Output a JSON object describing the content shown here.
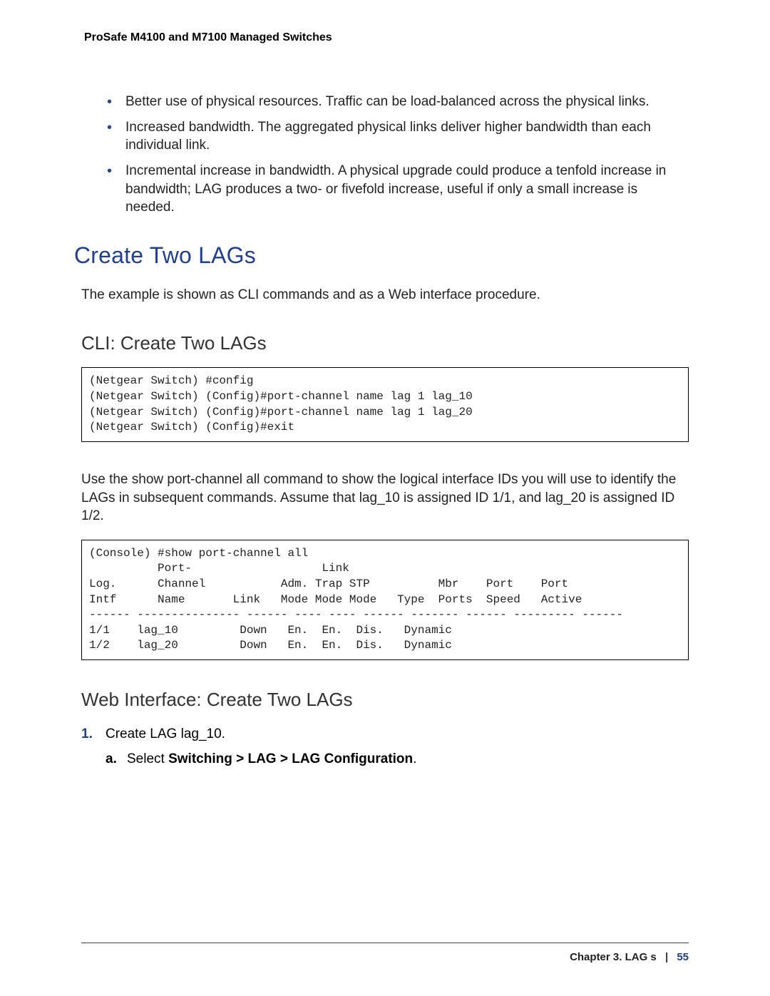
{
  "header": {
    "running_title": "ProSafe M4100 and M7100 Managed Switches"
  },
  "intro_bullets": [
    "Better use of physical resources. Traffic can be load-balanced across the physical links.",
    "Increased bandwidth. The aggregated physical links deliver higher bandwidth than each individual link.",
    "Incremental increase in bandwidth. A physical upgrade could produce a tenfold increase in bandwidth; LAG produces a two- or fivefold increase, useful if only a small increase is needed."
  ],
  "section_title": "Create Two LAGs",
  "section_intro": "The example is shown as CLI commands and as a Web interface procedure.",
  "cli_heading": "CLI: Create Two LAGs",
  "cli_block1": "(Netgear Switch) #config\n(Netgear Switch) (Config)#port-channel name lag 1 lag_10\n(Netgear Switch) (Config)#port-channel name lag 1 lag_20\n(Netgear Switch) (Config)#exit",
  "cli_narrative": "Use the show port-channel all command to show the logical interface IDs you will use to identify the LAGs in subsequent commands. Assume that lag_10 is assigned ID 1/1, and lag_20 is assigned ID 1/2.",
  "cli_block2": "(Console) #show port-channel all\n          Port-                   Link\nLog.      Channel           Adm. Trap STP          Mbr    Port    Port\nIntf      Name       Link   Mode Mode Mode   Type  Ports  Speed   Active\n------ --------------- ------ ---- ---- ------ ------- ------ --------- ------\n1/1    lag_10         Down   En.  En.  Dis.   Dynamic\n1/2    lag_20         Down   En.  En.  Dis.   Dynamic",
  "web_heading": "Web Interface: Create Two LAGs",
  "step1_label": "Create LAG lag_10.",
  "step1a_prefix": "Select ",
  "step1a_bold": "Switching > LAG > LAG Configuration",
  "step1a_suffix": ".",
  "footer": {
    "chapter": "Chapter 3.  LAG s",
    "page": "55"
  }
}
